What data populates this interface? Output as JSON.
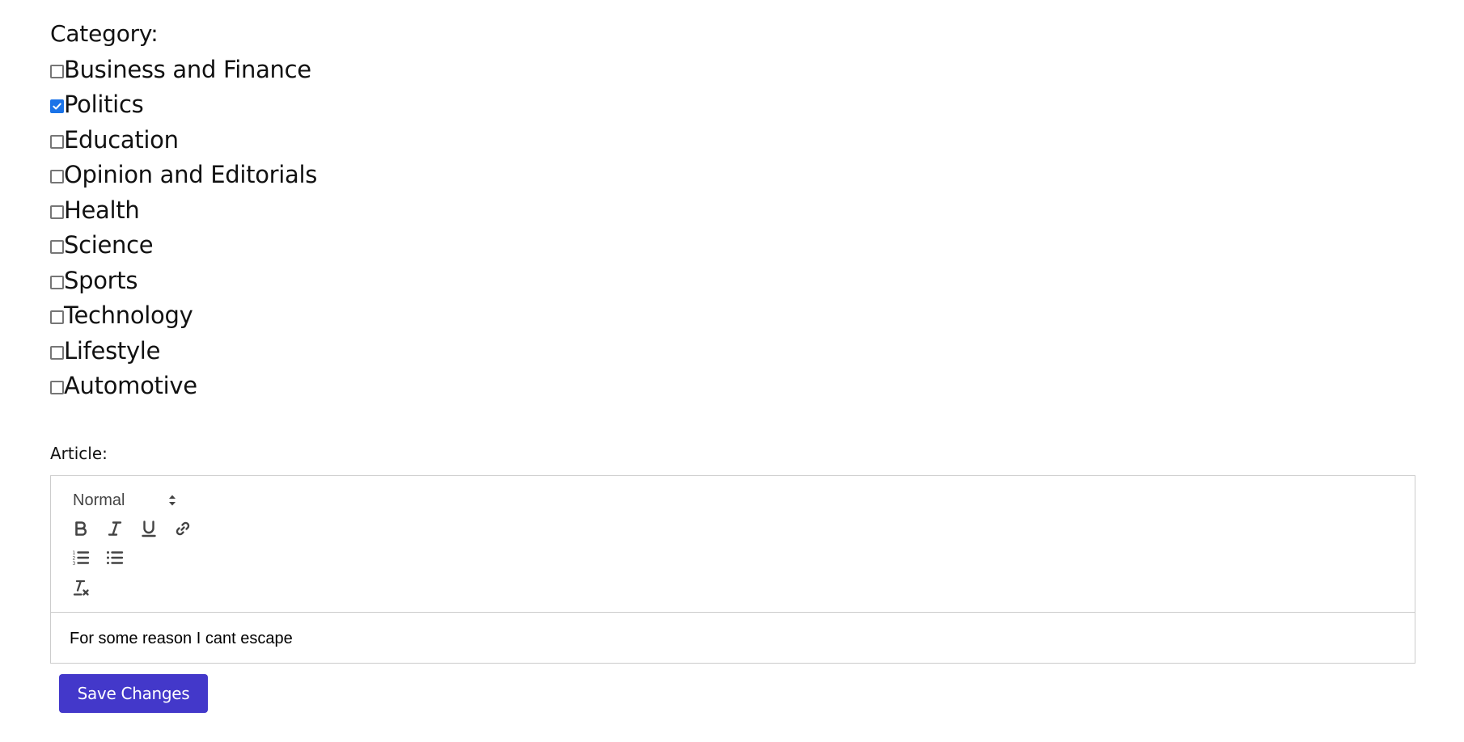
{
  "form": {
    "category_label": "Category:",
    "categories": [
      {
        "label": "Business and Finance",
        "checked": false
      },
      {
        "label": "Politics",
        "checked": true
      },
      {
        "label": "Education",
        "checked": false
      },
      {
        "label": "Opinion and Editorials",
        "checked": false
      },
      {
        "label": "Health",
        "checked": false
      },
      {
        "label": "Science",
        "checked": false
      },
      {
        "label": "Sports",
        "checked": false
      },
      {
        "label": "Technology",
        "checked": false
      },
      {
        "label": "Lifestyle",
        "checked": false
      },
      {
        "label": "Automotive",
        "checked": false
      }
    ],
    "article_label": "Article:",
    "save_label": "Save Changes"
  },
  "editor": {
    "header_value": "Normal",
    "content": "For some reason I cant escape",
    "toolbar_icons": [
      "bold-icon",
      "italic-icon",
      "underline-icon",
      "link-icon",
      "ordered-list-icon",
      "bullet-list-icon",
      "clear-format-icon"
    ]
  },
  "colors": {
    "checkbox_checked": "#1a73e8",
    "button_bg": "#4338ca",
    "border": "#cccccc"
  }
}
